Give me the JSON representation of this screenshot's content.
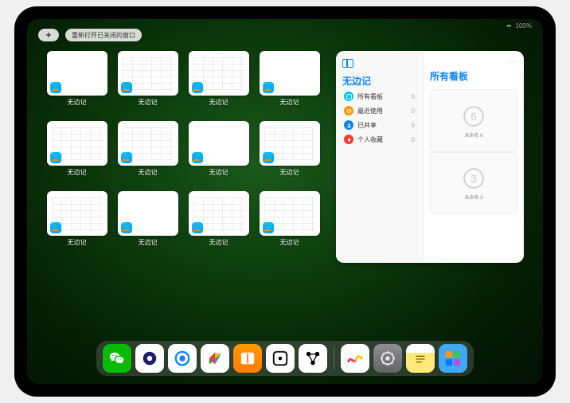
{
  "status": {
    "battery": "100%"
  },
  "topbar": {
    "add_label": "+",
    "reopen_label": "重新打开已关闭的窗口"
  },
  "thumbs": [
    {
      "label": "无边记",
      "variant": "blank"
    },
    {
      "label": "无边记",
      "variant": "calendar"
    },
    {
      "label": "无边记",
      "variant": "calendar"
    },
    {
      "label": "无边记",
      "variant": "blank"
    },
    {
      "label": "无边记",
      "variant": "calendar"
    },
    {
      "label": "无边记",
      "variant": "calendar"
    },
    {
      "label": "无边记",
      "variant": "blank"
    },
    {
      "label": "无边记",
      "variant": "calendar"
    },
    {
      "label": "无边记",
      "variant": "calendar"
    },
    {
      "label": "无边记",
      "variant": "blank"
    },
    {
      "label": "无边记",
      "variant": "calendar"
    },
    {
      "label": "无边记",
      "variant": "calendar"
    }
  ],
  "sidebar": {
    "title": "无边记",
    "items": [
      {
        "label": "所有看板",
        "count": "0",
        "color": "#00c3ff"
      },
      {
        "label": "最近使用",
        "count": "0",
        "color": "#ff9500"
      },
      {
        "label": "已共享",
        "count": "0",
        "color": "#0a84ff"
      },
      {
        "label": "个人收藏",
        "count": "0",
        "color": "#ff3b30"
      }
    ]
  },
  "boards_panel": {
    "title": "所有看板",
    "more": "···",
    "cards": [
      {
        "scribble": "6",
        "name": "未命名 6",
        "sub": ""
      },
      {
        "scribble": "3",
        "name": "未命名 3",
        "sub": ""
      }
    ]
  },
  "dock": [
    {
      "name": "wechat",
      "bg": "#09bb07"
    },
    {
      "name": "quark",
      "bg": "#ffffff"
    },
    {
      "name": "browser",
      "bg": "#ffffff"
    },
    {
      "name": "play",
      "bg": "#ffffff"
    },
    {
      "name": "books",
      "bg": "linear-gradient(#ff9a00,#ff7b00)"
    },
    {
      "name": "dice",
      "bg": "#ffffff"
    },
    {
      "name": "nodes",
      "bg": "#ffffff"
    },
    {
      "name": "freeform",
      "bg": "#ffffff"
    },
    {
      "name": "settings",
      "bg": "linear-gradient(#8e8e93,#636366)"
    },
    {
      "name": "notes",
      "bg": "linear-gradient(#fff 30%,#ffe97a 30%)"
    },
    {
      "name": "folder",
      "bg": "#3fa9f5"
    }
  ]
}
